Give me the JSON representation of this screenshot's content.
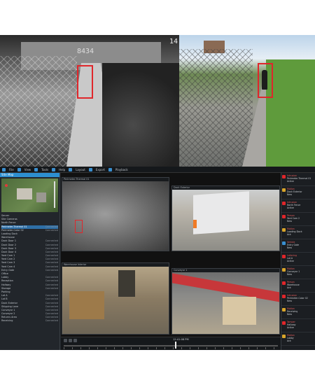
{
  "hero": {
    "thermal_camera_id": "8434",
    "color_camera_id": "14"
  },
  "toolbar": {
    "items": [
      "File",
      "View",
      "Tools",
      "Help",
      "Layout",
      "Export",
      "Playback"
    ]
  },
  "sidebar": {
    "header": "Site Map",
    "tree": [
      {
        "label": "Server",
        "tag": ""
      },
      {
        "label": "Site Cameras",
        "tag": ""
      },
      {
        "label": "North Fence",
        "tag": ""
      },
      {
        "label": "Perimeter-Thermal 01",
        "tag": "Connected",
        "selected": true
      },
      {
        "label": "Perimeter-Color 02",
        "tag": "Connected"
      },
      {
        "label": "Loading Dock",
        "tag": ""
      },
      {
        "label": "Warehouse",
        "tag": ""
      },
      {
        "label": "Dock Door 1",
        "tag": "Connected"
      },
      {
        "label": "Dock Door 2",
        "tag": "Connected"
      },
      {
        "label": "Dock Door 3",
        "tag": "Connected"
      },
      {
        "label": "Dock Door 4",
        "tag": "Connected"
      },
      {
        "label": "Yard Cam 1",
        "tag": "Connected"
      },
      {
        "label": "Yard Cam 2",
        "tag": "Connected"
      },
      {
        "label": "Yard Cam 3",
        "tag": "Connected"
      },
      {
        "label": "Yard Cam 4",
        "tag": "Connected"
      },
      {
        "label": "Entry Gate",
        "tag": "Connected"
      },
      {
        "label": "Office",
        "tag": ""
      },
      {
        "label": "Lobby",
        "tag": "Connected"
      },
      {
        "label": "Reception",
        "tag": "Connected"
      },
      {
        "label": "Hallway",
        "tag": "Connected"
      },
      {
        "label": "Storage",
        "tag": "Connected"
      },
      {
        "label": "Parking",
        "tag": ""
      },
      {
        "label": "Lot A",
        "tag": "Connected"
      },
      {
        "label": "Lot B",
        "tag": "Connected"
      },
      {
        "label": "Dock Exterior",
        "tag": "Connected"
      },
      {
        "label": "Shipping Lane",
        "tag": "Connected"
      },
      {
        "label": "Conveyor 1",
        "tag": "Connected"
      },
      {
        "label": "Conveyor 2",
        "tag": "Connected"
      },
      {
        "label": "Returns Area",
        "tag": "Connected"
      },
      {
        "label": "Receiving",
        "tag": "Connected"
      }
    ]
  },
  "tiles": {
    "t1": "Perimeter-Thermal 01",
    "t2": "Dock Exterior",
    "t3": "Warehouse Interior",
    "t4": "Conveyor 1"
  },
  "timeline": {
    "time": "12:41:08 PM",
    "progress": 0.52
  },
  "alarms": [
    {
      "title": "Intrusion",
      "detail": "Perimeter-Thermal 01",
      "status": "Active",
      "color": "#e0262b"
    },
    {
      "title": "Motion",
      "detail": "Dock Exterior",
      "status": "New",
      "color": "#d9a52b"
    },
    {
      "title": "Intrusion",
      "detail": "North Fence",
      "status": "Active",
      "color": "#e0262b"
    },
    {
      "title": "Person",
      "detail": "Yard Cam 2",
      "status": "New",
      "color": "#e0262b"
    },
    {
      "title": "Motion",
      "detail": "Loading Dock",
      "status": "Ack",
      "color": "#d9a52b"
    },
    {
      "title": "Vehicle",
      "detail": "Entry Gate",
      "status": "New",
      "color": "#3a8fd0"
    },
    {
      "title": "Loitering",
      "detail": "Lot A",
      "status": "Active",
      "color": "#e0262b"
    },
    {
      "title": "Motion",
      "detail": "Conveyor 1",
      "status": "New",
      "color": "#d9a52b"
    },
    {
      "title": "Person",
      "detail": "Warehouse",
      "status": "Ack",
      "color": "#e0262b"
    },
    {
      "title": "Intrusion",
      "detail": "Perimeter-Color 02",
      "status": "New",
      "color": "#e0262b"
    },
    {
      "title": "Motion",
      "detail": "Receiving",
      "status": "New",
      "color": "#d9a52b"
    },
    {
      "title": "Tamper",
      "detail": "Hallway",
      "status": "Active",
      "color": "#e0262b"
    },
    {
      "title": "Motion",
      "detail": "Lobby",
      "status": "Ack",
      "color": "#d9a52b"
    }
  ]
}
